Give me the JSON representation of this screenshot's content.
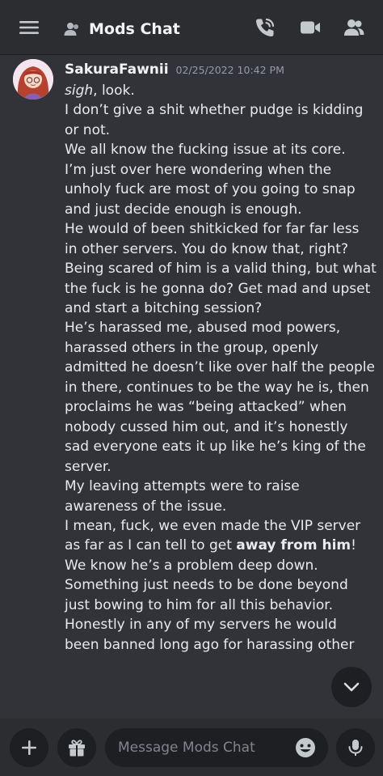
{
  "header": {
    "menu_icon": "hamburger-icon",
    "channel_icon": "member-icon",
    "title": "Mods Chat",
    "actions": [
      "voice-call-icon",
      "video-call-icon",
      "members-icon"
    ]
  },
  "message": {
    "author": "SakuraFawnii",
    "timestamp": "02/25/2022 10:42 PM",
    "line_01_italic": "sigh",
    "line_01_rest": ", look.",
    "line_02": "I don’t give a shit whether pudge is kidding",
    "line_03": "or not.",
    "line_04": "We all know the fucking issue at its core.",
    "line_05": "I’m just over here wondering when the",
    "line_06": "unholy fuck are most of you going to snap",
    "line_07": "and just decide enough is enough.",
    "line_08": "He would of been shitkicked for far  far less",
    "line_09": "in other servers. You do know that, right?",
    "line_10": "Being scared of him is a valid thing, but what",
    "line_11": "the fuck is he gonna do? Get mad and upset",
    "line_12": "and start a bitching session?",
    "line_13": "He’s harassed me, abused mod powers,",
    "line_14": "harassed others in the group, openly",
    "line_15": "admitted he doesn’t like over half the people",
    "line_16": "in there, continues to be the way he is, then",
    "line_17": "proclaims he was “being attacked” when",
    "line_18": "nobody cussed him out, and it’s honestly",
    "line_19": "sad everyone eats it up like he’s king of the",
    "line_20": "server.",
    "line_21": "My leaving attempts were to raise",
    "line_22": "awareness of the issue.",
    "line_23": "I mean, fuck, we even made the VIP server",
    "line_24_start": "as far as I can tell to get ",
    "line_24_bold": "away from him",
    "line_24_end": "!",
    "line_25": "We know he’s a problem deep down.",
    "line_26": "Something just needs to be done beyond",
    "line_27": "just bowing to him for all this behavior.",
    "line_28": "Honestly in any of my servers he would",
    "line_29": "been banned long ago for harassing other"
  },
  "composer": {
    "placeholder": "Message Mods Chat",
    "value": ""
  },
  "colors": {
    "background": "#313338",
    "header_bg": "#2b2d31",
    "input_bg": "#1e1f22",
    "text": "#f2f3f5",
    "muted": "#949ba4"
  }
}
